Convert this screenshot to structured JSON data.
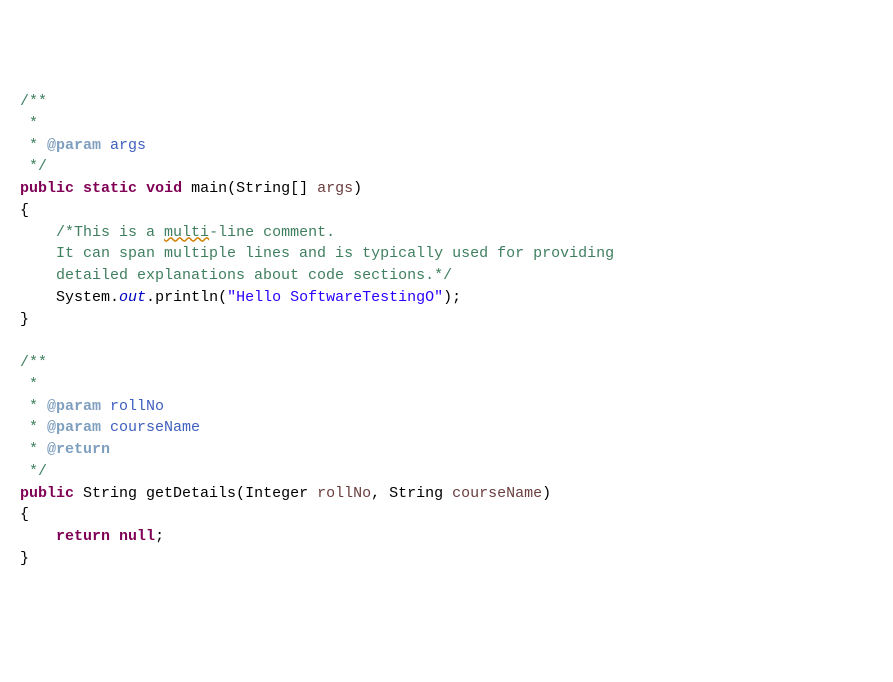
{
  "lines": {
    "l1": "/**",
    "l2_star": " *",
    "l3_star": " * ",
    "l3_tag": "@param",
    "l3_param": " args",
    "l4": " */",
    "l5_kw1": "public",
    "l5_kw2": "static",
    "l5_kw3": "void",
    "l5_mname": " main",
    "l5_p1": "(",
    "l5_type": "String[] ",
    "l5_arg": "args",
    "l5_p2": ")",
    "l6": "{",
    "l7_ind": "    ",
    "l7_c1": "/*This is a ",
    "l7_spell": "multi",
    "l7_c2": "-line comment.",
    "l8_ind": "    ",
    "l8_c": "It can span multiple lines and is typically used for providing",
    "l9_ind": "    ",
    "l9_c": "detailed explanations about code sections.*/",
    "l10_ind": "    ",
    "l10_sys": "System.",
    "l10_out": "out",
    "l10_dot": ".",
    "l10_m": "println",
    "l10_p1": "(",
    "l10_str": "\"Hello SoftwareTestingO\"",
    "l10_p2": ");",
    "l11": "}",
    "l13": "/**",
    "l14_star": " *",
    "l15_star": " * ",
    "l15_tag": "@param",
    "l15_param": " rollNo",
    "l16_star": " * ",
    "l16_tag": "@param",
    "l16_param": " courseName",
    "l17_star": " * ",
    "l17_tag": "@return",
    "l18": " */",
    "l19_kw1": "public",
    "l19_type": " String ",
    "l19_mname": "getDetails",
    "l19_p1": "(",
    "l19_t1": "Integer ",
    "l19_a1": "rollNo",
    "l19_comma": ", ",
    "l19_t2": "String ",
    "l19_a2": "courseName",
    "l19_p2": ")",
    "l20": "{",
    "l21_ind": "    ",
    "l21_kw": "return",
    "l21_sp": " ",
    "l21_null": "null",
    "l21_semi": ";",
    "l22": "}"
  }
}
